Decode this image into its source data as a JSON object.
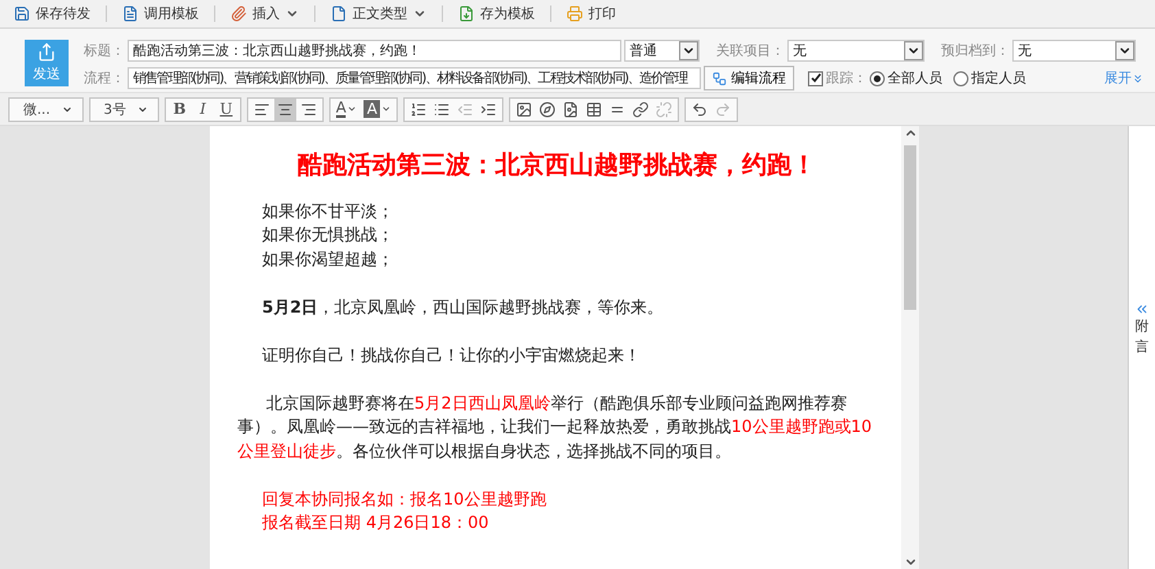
{
  "toolbar": [
    {
      "label": "保存待发",
      "dropdown": false
    },
    {
      "label": "调用模板",
      "dropdown": false
    },
    {
      "label": "插入",
      "dropdown": true
    },
    {
      "label": "正文类型",
      "dropdown": true
    },
    {
      "label": "存为模板",
      "dropdown": false
    },
    {
      "label": "打印",
      "dropdown": false
    }
  ],
  "send_button": {
    "label": "发送"
  },
  "header": {
    "title_label": "标题：",
    "title_value": "酷跑活动第三波：北京西山越野挑战赛，约跑！",
    "priority": "普通",
    "project_label": "关联项目：",
    "project_value": "无",
    "archive_label": "预归档到：",
    "archive_value": "无",
    "flow_label": "流程：",
    "flow_value": "销售管理部(协同)、营销策划部(协同)、质量管理部(协同)、材料设备部(协同)、工程技术部(协同)、造价管理",
    "edit_flow_button": "编辑流程",
    "track": {
      "label": "跟踪：",
      "checked": true
    },
    "track_options": [
      {
        "label": "全部人员",
        "selected": true
      },
      {
        "label": "指定人员",
        "selected": false
      }
    ],
    "expand_link": "展开"
  },
  "editor_toolbar": [
    [
      {
        "kind": "select",
        "label": "微..."
      }
    ],
    [
      {
        "kind": "select",
        "label": "3号"
      }
    ],
    [
      {
        "kind": "text",
        "label": "B"
      },
      {
        "kind": "text",
        "label": "I"
      },
      {
        "kind": "text",
        "label": "U"
      }
    ],
    [
      {
        "kind": "icon",
        "selected": false,
        "disabled": false
      },
      {
        "kind": "icon",
        "selected": true,
        "disabled": false
      },
      {
        "kind": "icon",
        "selected": false,
        "disabled": false
      }
    ],
    [
      {
        "kind": "color",
        "label": "A"
      },
      {
        "kind": "color",
        "label": "A"
      }
    ],
    [
      {
        "kind": "icon",
        "selected": false,
        "disabled": false
      },
      {
        "kind": "icon",
        "selected": false,
        "disabled": false
      },
      {
        "kind": "icon",
        "selected": false,
        "disabled": true
      },
      {
        "kind": "icon",
        "selected": false,
        "disabled": false
      }
    ],
    [
      {
        "kind": "icon",
        "selected": false,
        "disabled": false
      },
      {
        "kind": "icon",
        "selected": false,
        "disabled": false
      },
      {
        "kind": "icon",
        "selected": false,
        "disabled": false
      },
      {
        "kind": "icon",
        "selected": false,
        "disabled": false
      },
      {
        "kind": "icon",
        "selected": false,
        "disabled": false
      },
      {
        "kind": "icon",
        "selected": false,
        "disabled": false
      },
      {
        "kind": "icon",
        "selected": false,
        "disabled": true
      }
    ],
    [
      {
        "kind": "icon",
        "selected": false,
        "disabled": false
      },
      {
        "kind": "icon",
        "selected": false,
        "disabled": true
      }
    ]
  ],
  "document": {
    "title": "酷跑活动第三波：北京西山越野挑战赛，约跑！",
    "blocks": [
      [
        {
          "kind": "line",
          "segments": [
            {
              "text": "如果你不甘平淡；",
              "red": false
            }
          ]
        },
        {
          "kind": "line",
          "segments": [
            {
              "text": "如果你无惧挑战；",
              "red": false
            }
          ]
        },
        {
          "kind": "line",
          "segments": [
            {
              "text": "如果你渴望超越；",
              "red": false
            }
          ]
        }
      ],
      [
        {
          "kind": "line",
          "segments": [
            {
              "text": "**5月2日**，北京凤凰岭，西山国际越野挑战赛，等你来。",
              "red": false
            }
          ]
        }
      ],
      [
        {
          "kind": "line",
          "segments": [
            {
              "text": "证明你自己！挑战你自己！让你的小宇宙燃烧起来！",
              "red": false
            }
          ]
        }
      ],
      [
        {
          "kind": "paragraph",
          "segments": [
            {
              "text": "北京国际越野赛将在",
              "red": false
            },
            {
              "text": "5月2日西山凤凰岭",
              "red": true
            },
            {
              "text": "举行（酷跑俱乐部专业顾问益跑网推荐赛事）。凤凰岭——致远的吉祥福地，让我们一起释放热爱，勇敢挑战",
              "red": false
            },
            {
              "text": "10公里越野跑或10公里登山徒步",
              "red": true
            },
            {
              "text": "。各位伙伴可以根据自身状态，选择挑战不同的项目。",
              "red": false
            }
          ]
        }
      ],
      [
        {
          "kind": "line",
          "segments": [
            {
              "text": "回复本协同报名如：报名10公里越野跑",
              "red": true
            }
          ]
        },
        {
          "kind": "line",
          "segments": [
            {
              "text": "报名截至日期  4月26日18：00",
              "red": true
            }
          ]
        }
      ]
    ]
  },
  "side_panel": {
    "label": "附言"
  }
}
